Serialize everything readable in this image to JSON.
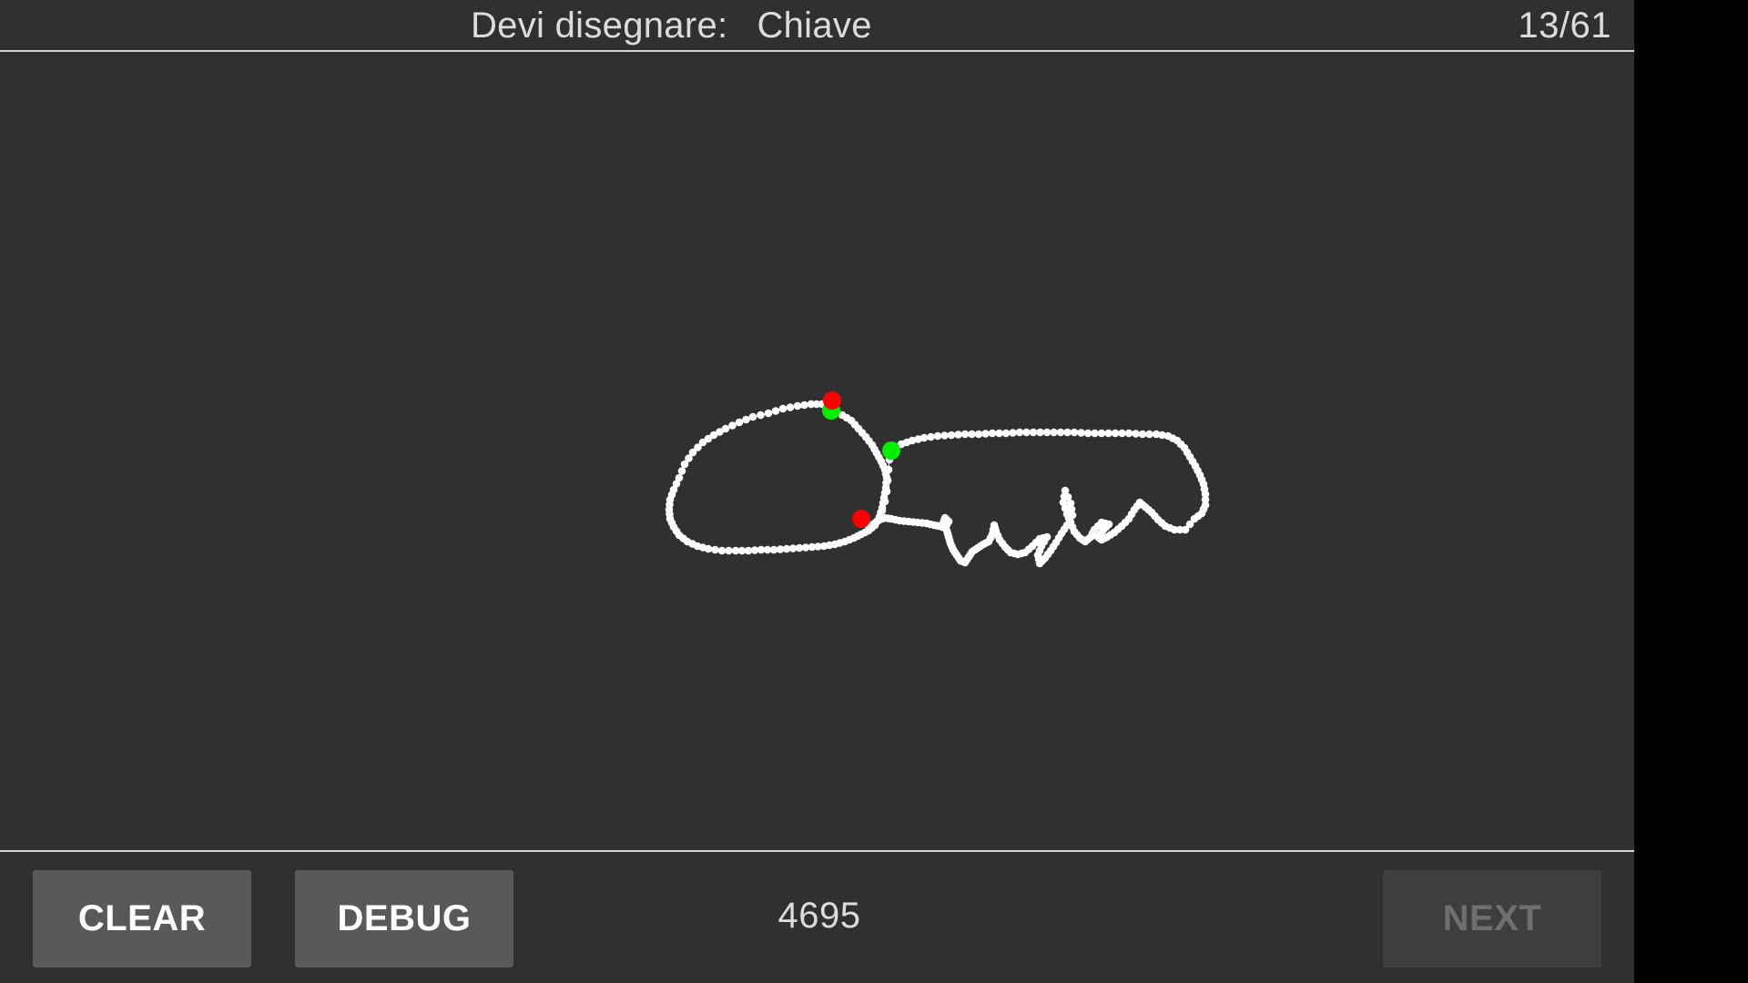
{
  "header": {
    "prompt_label": "Devi disegnare:",
    "word": "Chiave",
    "progress": "13/61"
  },
  "drawing": {
    "stroke_color": "#ffffff",
    "start_marker_color": "#00ee00",
    "end_marker_color": "#ff0000",
    "stroke_count": 2
  },
  "footer": {
    "clear_label": "CLEAR",
    "debug_label": "DEBUG",
    "score": "4695",
    "next_label": "NEXT"
  },
  "colors": {
    "background": "#303030",
    "button": "#595959",
    "button_disabled": "#3e3e3e"
  }
}
